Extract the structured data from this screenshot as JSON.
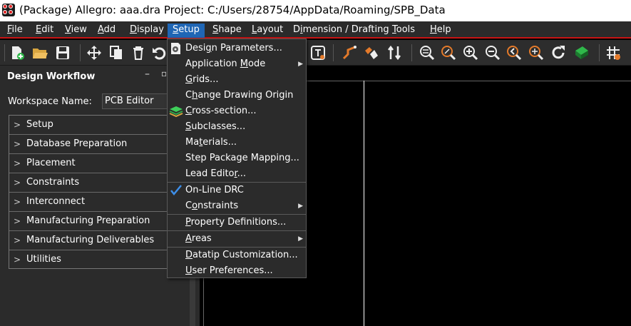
{
  "window": {
    "title": "(Package) Allegro: aaa.dra  Project: C:/Users/28754/AppData/Roaming/SPB_Data"
  },
  "menubar": {
    "items": [
      {
        "label": "File",
        "ul": "F",
        "rest": "ile"
      },
      {
        "label": "Edit",
        "ul": "E",
        "rest": "dit"
      },
      {
        "label": "View",
        "ul": "V",
        "rest": "iew"
      },
      {
        "label": "Add",
        "ul": "A",
        "rest": "dd"
      },
      {
        "label": "Display",
        "ul": "D",
        "rest": "isplay"
      },
      {
        "label": "Setup",
        "ul": "S",
        "rest": "etup"
      },
      {
        "label": "Shape",
        "ul": "S",
        "rest": "hape"
      },
      {
        "label": "Layout",
        "ul": "L",
        "rest": "ayout"
      },
      {
        "label": "Dimension / Drafting",
        "pre": "D",
        "ul": "i",
        "rest": "mension / Drafting"
      },
      {
        "label": "Tools",
        "ul": "T",
        "rest": "ools"
      },
      {
        "label": "Help",
        "ul": "H",
        "rest": "elp"
      }
    ]
  },
  "toolbar": {
    "icons": [
      "new-design-icon",
      "open-folder-icon",
      "save-icon",
      "move-icon",
      "copy-icon",
      "delete-icon",
      "undo-icon",
      "text-edit-icon",
      "add-connect-icon",
      "slide-icon",
      "swap-icon",
      "zoom-fit-icon",
      "zoom-in-area-icon",
      "zoom-in-icon",
      "zoom-out-icon",
      "zoom-previous-icon",
      "zoom-world-icon",
      "redraw-icon",
      "board-3d-icon",
      "grid-toggle-icon"
    ]
  },
  "workflow": {
    "title": "Design Workflow",
    "workspace_label": "Workspace Name:",
    "workspace_value": "PCB Editor",
    "items": [
      "Setup",
      "Database Preparation",
      "Placement",
      "Constraints",
      "Interconnect",
      "Manufacturing Preparation",
      "Manufacturing Deliverables",
      "Utilities"
    ]
  },
  "setup_menu": {
    "items": [
      {
        "label": "Design Parameters...",
        "pre": "Desi",
        "ul": "g",
        "rest": "n Parameters...",
        "icon": "design-parameters-icon"
      },
      {
        "label": "Application Mode",
        "pre": "Application ",
        "ul": "M",
        "rest": "ode",
        "submenu": true
      },
      {
        "label": "Grids...",
        "pre": "",
        "ul": "G",
        "rest": "rids..."
      },
      {
        "label": "Change Drawing Origin",
        "pre": "C",
        "ul": "h",
        "rest": "ange Drawing Origin"
      },
      {
        "label": "Cross-section...",
        "pre": "",
        "ul": "C",
        "rest": "ross-section...",
        "icon": "cross-section-icon"
      },
      {
        "label": "Subclasses...",
        "pre": "",
        "ul": "S",
        "rest": "ubclasses..."
      },
      {
        "label": "Materials...",
        "pre": "Ma",
        "ul": "t",
        "rest": "erials..."
      },
      {
        "label": "Step Package Mapping...",
        "pre": "Step Package Mapping...",
        "ul": "",
        "rest": ""
      },
      {
        "label": "Lead Editor...",
        "pre": "Lead Edito",
        "ul": "r",
        "rest": "..."
      },
      {
        "label": "On-Line DRC",
        "pre": "On-Line DRC",
        "ul": "",
        "rest": "",
        "checked": true
      },
      {
        "label": "Constraints",
        "pre": "C",
        "ul": "o",
        "rest": "nstraints",
        "submenu": true
      },
      {
        "label": "Property Definitions...",
        "pre": "",
        "ul": "P",
        "rest": "roperty Definitions..."
      },
      {
        "label": "Areas",
        "pre": "",
        "ul": "A",
        "rest": "reas",
        "submenu": true
      },
      {
        "label": "Datatip Customization...",
        "pre": "",
        "ul": "D",
        "rest": "atatip Customization..."
      },
      {
        "label": "User Preferences...",
        "pre": "",
        "ul": "U",
        "rest": "ser Preferences..."
      }
    ]
  },
  "colors": {
    "menubar_accent": "#c81414",
    "active_menu": "#1f66b5",
    "check": "#3d8ee8"
  }
}
